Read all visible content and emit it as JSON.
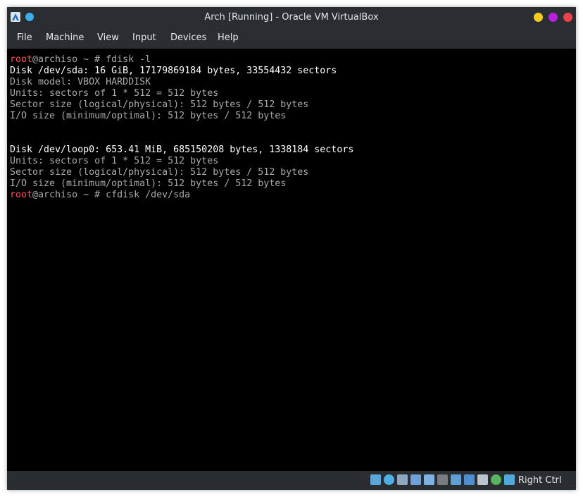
{
  "window": {
    "title": "Arch [Running] - Oracle VM VirtualBox"
  },
  "menu": [
    "File",
    "Machine",
    "View",
    "Input",
    "Devices",
    "Help"
  ],
  "console": {
    "prompt_user": "root",
    "prompt_rest": "@archiso ~ # ",
    "cmd1": "fdisk -l",
    "lines": [
      {
        "text": "Disk /dev/sda: 16 GiB, 17179869184 bytes, 33554432 sectors",
        "bright": true
      },
      {
        "text": "Disk model: VBOX HARDDISK",
        "bright": false
      },
      {
        "text": "Units: sectors of 1 * 512 = 512 bytes",
        "bright": false
      },
      {
        "text": "Sector size (logical/physical): 512 bytes / 512 bytes",
        "bright": false
      },
      {
        "text": "I/O size (minimum/optimal): 512 bytes / 512 bytes",
        "bright": false
      },
      {
        "text": "",
        "bright": false
      },
      {
        "text": "",
        "bright": false
      },
      {
        "text": "Disk /dev/loop0: 653.41 MiB, 685150208 bytes, 1338184 sectors",
        "bright": true
      },
      {
        "text": "Units: sectors of 1 * 512 = 512 bytes",
        "bright": false
      },
      {
        "text": "Sector size (logical/physical): 512 bytes / 512 bytes",
        "bright": false
      },
      {
        "text": "I/O size (minimum/optimal): 512 bytes / 512 bytes",
        "bright": false
      }
    ],
    "cmd2": "cfdisk /dev/sda"
  },
  "statusbar": {
    "icons": [
      "hard-disk-icon",
      "optical-drive-icon",
      "audio-icon",
      "network-icon",
      "usb-icon",
      "shared-folders-icon",
      "display-icon",
      "recording-icon",
      "virtualization-icon",
      "mouse-integration-icon",
      "keyboard-icon"
    ],
    "host_key": "Right Ctrl"
  },
  "colors": {
    "window_bg": "#2a2e32",
    "console_bg": "#000000",
    "prompt_user": "#ff5555",
    "min": "#f6c91b",
    "max": "#b81fe0",
    "close": "#f0404a"
  }
}
